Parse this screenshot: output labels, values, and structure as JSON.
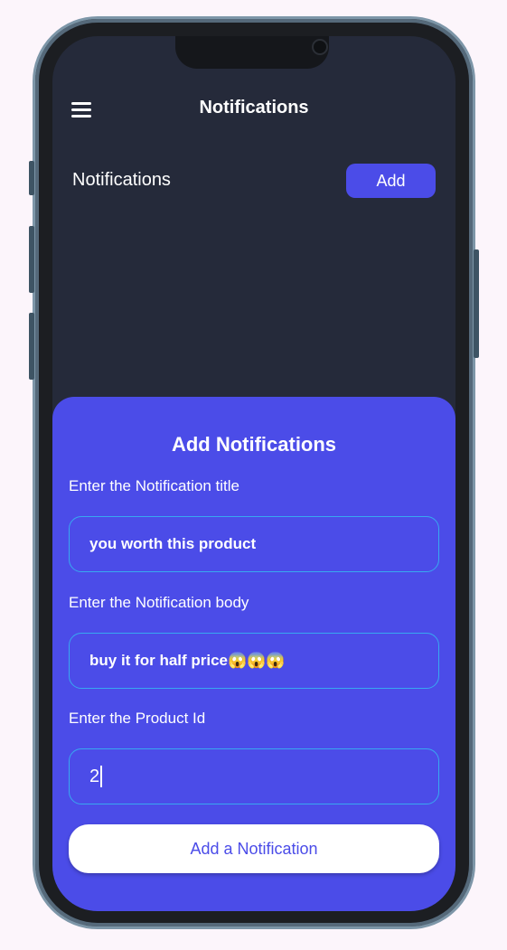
{
  "header": {
    "title": "Notifications"
  },
  "main": {
    "section_label": "Notifications",
    "add_button": "Add"
  },
  "sheet": {
    "title": "Add Notifications",
    "fields": [
      {
        "label": "Enter the Notification title",
        "value": "you worth this product"
      },
      {
        "label": "Enter the Notification body",
        "value": "buy it for half price",
        "emoji": "😱😱😱"
      },
      {
        "label": "Enter the Product Id",
        "value": "2"
      }
    ],
    "submit_button": "Add a Notification"
  },
  "colors": {
    "screen_bg": "#252a3a",
    "accent": "#4b4ce8",
    "field_border": "#38a8f0",
    "page_bg": "#fcf5fb"
  },
  "icons": [
    "menu-icon",
    "camera-icon"
  ]
}
